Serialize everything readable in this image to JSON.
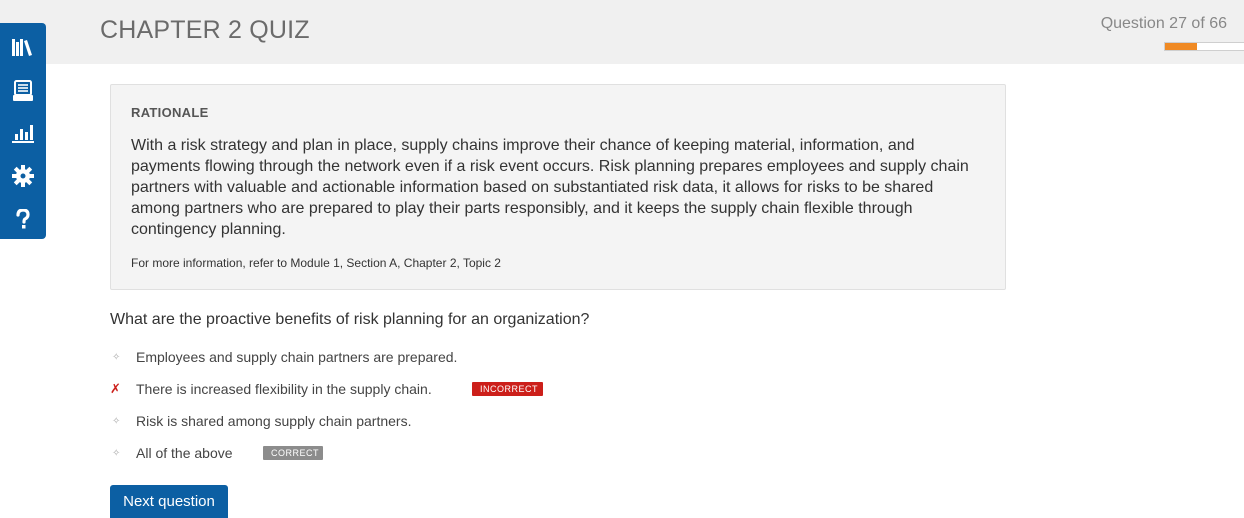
{
  "header": {
    "title": "CHAPTER 2 QUIZ",
    "progress_label": "Question 27 of 66",
    "progress_fraction": 0.41,
    "accent_color": "#f08a24"
  },
  "sidebar": {
    "color": "#0c5fa3",
    "items": [
      {
        "icon": "library-icon"
      },
      {
        "icon": "flashcards-icon"
      },
      {
        "icon": "stats-icon"
      },
      {
        "icon": "gear-icon"
      },
      {
        "icon": "help-icon"
      }
    ]
  },
  "rationale": {
    "heading": "RATIONALE",
    "body": "With a risk strategy and plan in place, supply chains improve their chance of keeping material, information, and payments flowing through the network even if a risk event occurs. Risk planning prepares employees and supply chain partners with valuable and actionable information based on substantiated risk data, it allows for risks to be shared among partners who are prepared to play their parts responsibly, and it keeps the supply chain flexible through contingency planning.",
    "reference": "For more information, refer to Module 1, Section A, Chapter 2, Topic 2"
  },
  "question": {
    "text": "What are the proactive benefits of risk planning for an organization?",
    "answers": [
      {
        "marker": "✧",
        "text": "Employees and supply chain partners are prepared.",
        "badge": ""
      },
      {
        "marker": "✗",
        "text": "There is increased flexibility in the supply chain.",
        "badge": "INCORRECT"
      },
      {
        "marker": "✧",
        "text": "Risk is shared among supply chain partners.",
        "badge": ""
      },
      {
        "marker": "✧",
        "text": "All of the above",
        "badge": "CORRECT"
      }
    ]
  },
  "actions": {
    "next_label": "Next question"
  },
  "colors": {
    "incorrect": "#cc1f1a",
    "correct": "#8c8c8c"
  }
}
